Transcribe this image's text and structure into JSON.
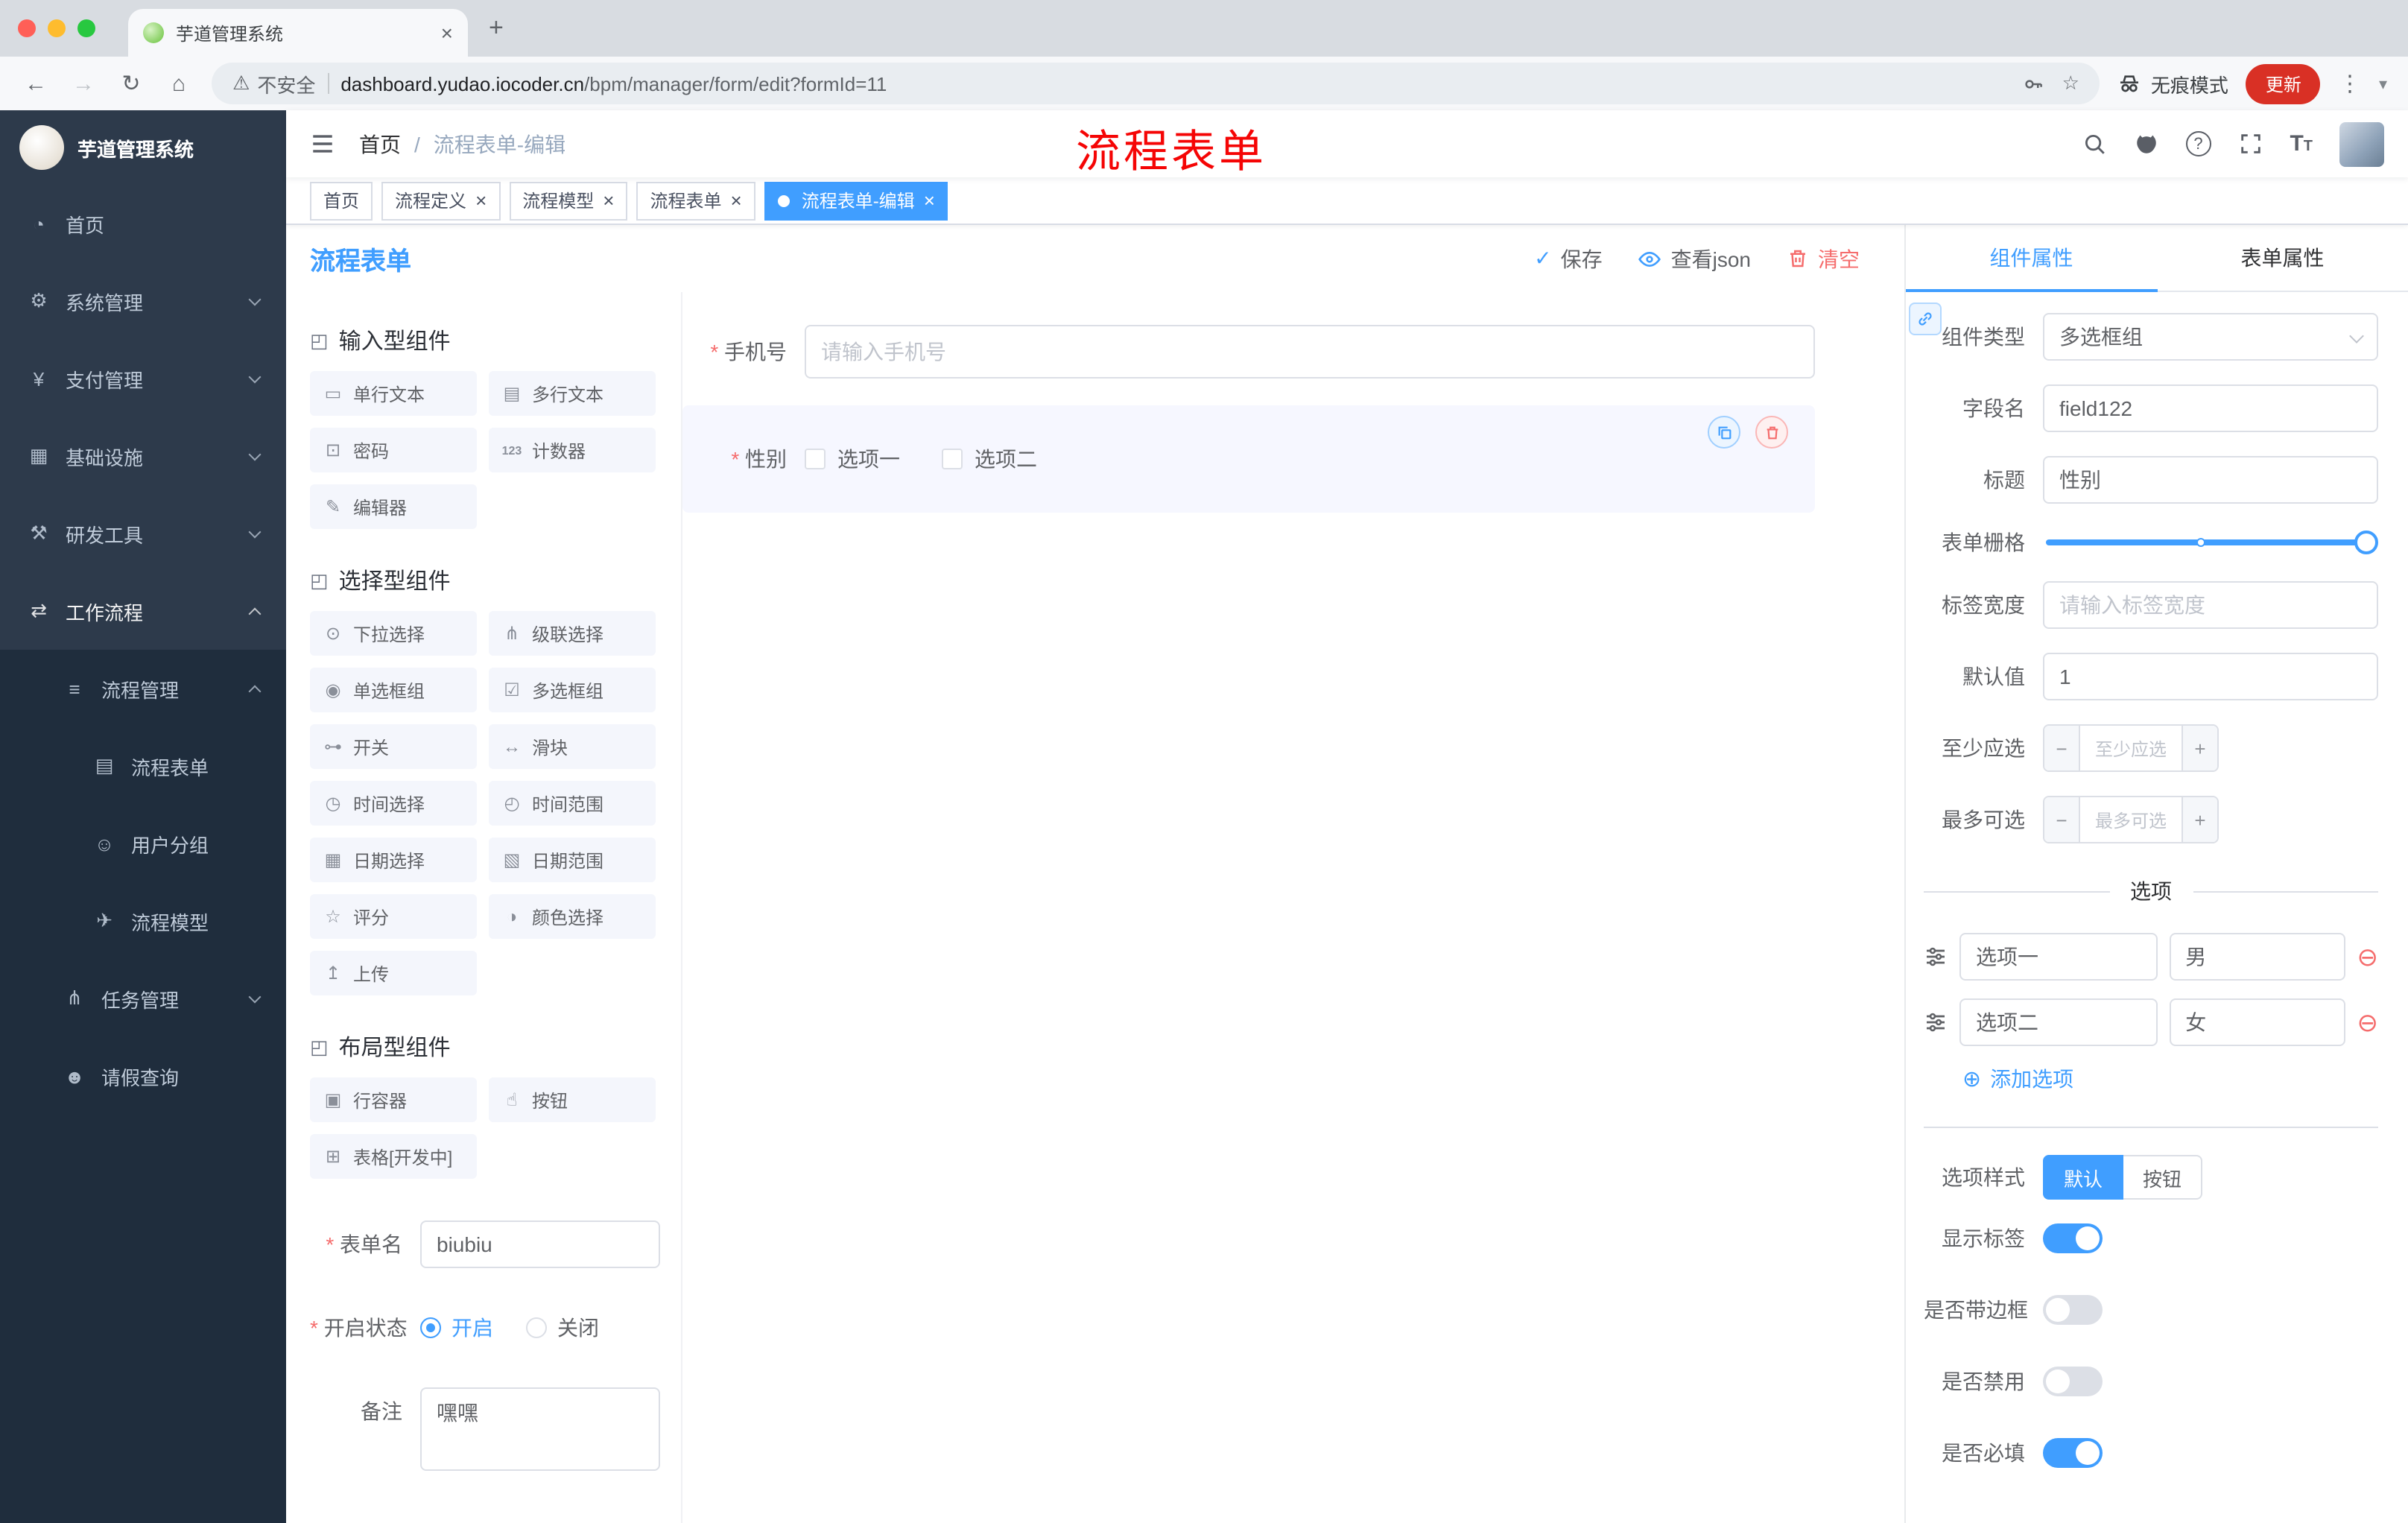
{
  "browser": {
    "tab_title": "芋道管理系统",
    "security_label": "不安全",
    "url_domain": "dashboard.yudao.iocoder.cn",
    "url_path": "/bpm/manager/form/edit?formId=11",
    "incognito_label": "无痕模式",
    "update_label": "更新"
  },
  "navbar": {
    "breadcrumb_home": "首页",
    "breadcrumb_separator": "/",
    "breadcrumb_current": "流程表单-编辑",
    "annotation": "流程表单"
  },
  "tags": {
    "items": [
      {
        "label": "首页"
      },
      {
        "label": "流程定义"
      },
      {
        "label": "流程模型"
      },
      {
        "label": "流程表单"
      },
      {
        "label": "流程表单-编辑"
      }
    ]
  },
  "sidebar": {
    "logo_title": "芋道管理系统",
    "items": [
      {
        "label": "首页",
        "icon": "◔"
      },
      {
        "label": "系统管理",
        "icon": "⚙"
      },
      {
        "label": "支付管理",
        "icon": "¥"
      },
      {
        "label": "基础设施",
        "icon": "▦"
      },
      {
        "label": "研发工具",
        "icon": "⚒"
      },
      {
        "label": "工作流程",
        "icon": "⇄"
      },
      {
        "label": "流程管理",
        "icon": "≡"
      },
      {
        "label": "流程表单",
        "icon": "▤"
      },
      {
        "label": "用户分组",
        "icon": "☺"
      },
      {
        "label": "流程模型",
        "icon": "✈"
      },
      {
        "label": "任务管理",
        "icon": "⋔"
      },
      {
        "label": "请假查询",
        "icon": "☻"
      }
    ]
  },
  "designer": {
    "page_title": "流程表单",
    "save_label": "保存",
    "view_json_label": "查看json",
    "clear_label": "清空"
  },
  "palette": {
    "sections": [
      {
        "title": "输入型组件",
        "icon": "◰",
        "items": [
          {
            "icon": "▭",
            "label": "单行文本"
          },
          {
            "icon": "▤",
            "label": "多行文本"
          },
          {
            "icon": "⊡",
            "label": "密码"
          },
          {
            "icon": "123",
            "label": "计数器"
          },
          {
            "icon": "✎",
            "label": "编辑器"
          }
        ]
      },
      {
        "title": "选择型组件",
        "icon": "◰",
        "items": [
          {
            "icon": "⊙",
            "label": "下拉选择"
          },
          {
            "icon": "⋔",
            "label": "级联选择"
          },
          {
            "icon": "◉",
            "label": "单选框组"
          },
          {
            "icon": "☑",
            "label": "多选框组"
          },
          {
            "icon": "⊶",
            "label": "开关"
          },
          {
            "icon": "↔",
            "label": "滑块"
          },
          {
            "icon": "◷",
            "label": "时间选择"
          },
          {
            "icon": "◴",
            "label": "时间范围"
          },
          {
            "icon": "▦",
            "label": "日期选择"
          },
          {
            "icon": "▧",
            "label": "日期范围"
          },
          {
            "icon": "☆",
            "label": "评分"
          },
          {
            "icon": "◑",
            "label": "颜色选择"
          },
          {
            "icon": "↥",
            "label": "上传"
          }
        ]
      },
      {
        "title": "布局型组件",
        "icon": "◰",
        "items": [
          {
            "icon": "▣",
            "label": "行容器"
          },
          {
            "icon": "☝",
            "label": "按钮"
          },
          {
            "icon": "⊞",
            "label": "表格[开发中]"
          }
        ]
      }
    ]
  },
  "form_meta": {
    "name_label": "表单名",
    "name_value": "biubiu",
    "status_label": "开启状态",
    "status_on": "开启",
    "status_off": "关闭",
    "remark_label": "备注",
    "remark_value": "嘿嘿"
  },
  "canvas": {
    "phone_label": "手机号",
    "phone_placeholder": "请输入手机号",
    "gender_label": "性别",
    "gender_option1": "选项一",
    "gender_option2": "选项二"
  },
  "props": {
    "tab_component": "组件属性",
    "tab_form": "表单属性",
    "component_type_label": "组件类型",
    "component_type_value": "多选框组",
    "field_name_label": "字段名",
    "field_name_value": "field122",
    "title_label": "标题",
    "title_value": "性别",
    "grid_label": "表单栅格",
    "label_width_label": "标签宽度",
    "label_width_placeholder": "请输入标签宽度",
    "default_label": "默认值",
    "default_value": "1",
    "min_label": "至少应选",
    "min_placeholder": "至少应选",
    "max_label": "最多可选",
    "max_placeholder": "最多可选",
    "options_title": "选项",
    "option1_name": "选项一",
    "option1_value": "男",
    "option2_name": "选项二",
    "option2_value": "女",
    "add_option_label": "添加选项",
    "style_label": "选项样式",
    "style_default": "默认",
    "style_button": "按钮",
    "show_label_label": "显示标签",
    "border_label": "是否带边框",
    "disabled_label": "是否禁用",
    "required_label": "是否必填"
  },
  "icons": {
    "back": "←",
    "forward": "→",
    "reload": "↻",
    "home": "⌂",
    "warning": "⚠",
    "star": "☆",
    "kebab": "⋮",
    "new_tab": "+",
    "close": "×",
    "check": "✓",
    "help": "?",
    "font_big": "T",
    "font_small": "T",
    "add_circle": "⊕",
    "minus": "−",
    "plus": "+",
    "dropdown": "▾",
    "remove_circle": "⊖"
  },
  "colors": {
    "accent": "#409eff",
    "danger": "#f56c6c",
    "annotation_red": "#f50505",
    "sidebar_bg": "#2d3a4b",
    "submenu_bg": "#1f2d3d",
    "active_tag": "#409eff",
    "update_button": "#d93025",
    "mac_close": "#ff5f57",
    "mac_minimize": "#febc2e",
    "mac_maximize": "#28c840"
  }
}
